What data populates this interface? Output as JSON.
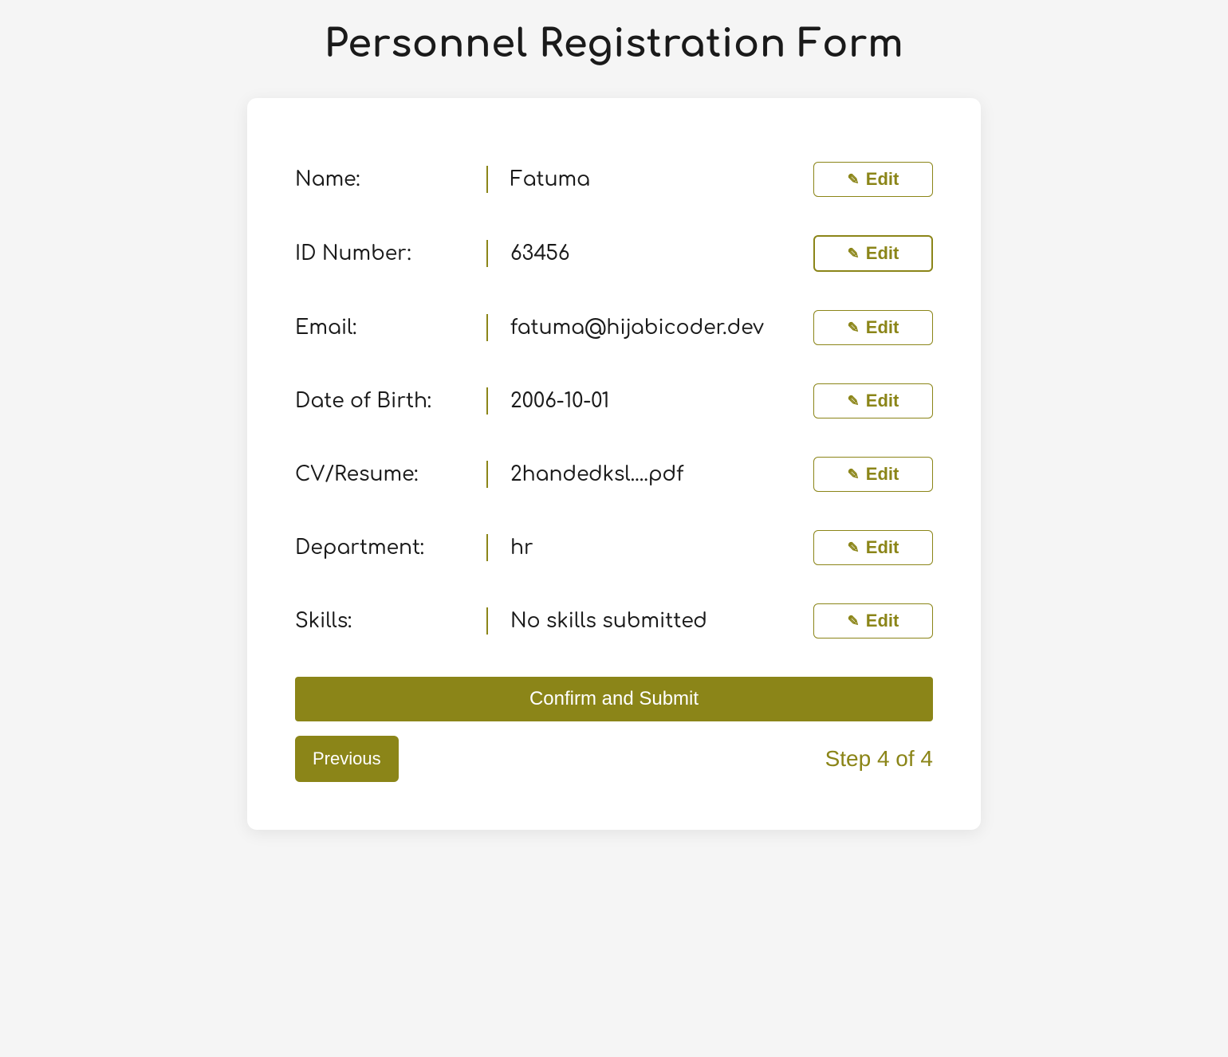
{
  "title": "Personnel Registration Form",
  "fields": [
    {
      "label": "Name:",
      "value": "Fatuma",
      "edit_label": "Edit",
      "active": false
    },
    {
      "label": "ID Number:",
      "value": "63456",
      "edit_label": "Edit",
      "active": true
    },
    {
      "label": "Email:",
      "value": "fatuma@hijabicoder.dev",
      "edit_label": "Edit",
      "active": false
    },
    {
      "label": "Date of Birth:",
      "value": "2006-10-01",
      "edit_label": "Edit",
      "active": false
    },
    {
      "label": "CV/Resume:",
      "value": "2handedksl....pdf",
      "edit_label": "Edit",
      "active": false
    },
    {
      "label": "Department:",
      "value": "hr",
      "edit_label": "Edit",
      "active": false
    },
    {
      "label": "Skills:",
      "value": "No skills submitted",
      "edit_label": "Edit",
      "active": false
    }
  ],
  "buttons": {
    "submit": "Confirm and Submit",
    "previous": "Previous"
  },
  "step_indicator": "Step 4 of 4",
  "icons": {
    "pencil": "✎"
  }
}
